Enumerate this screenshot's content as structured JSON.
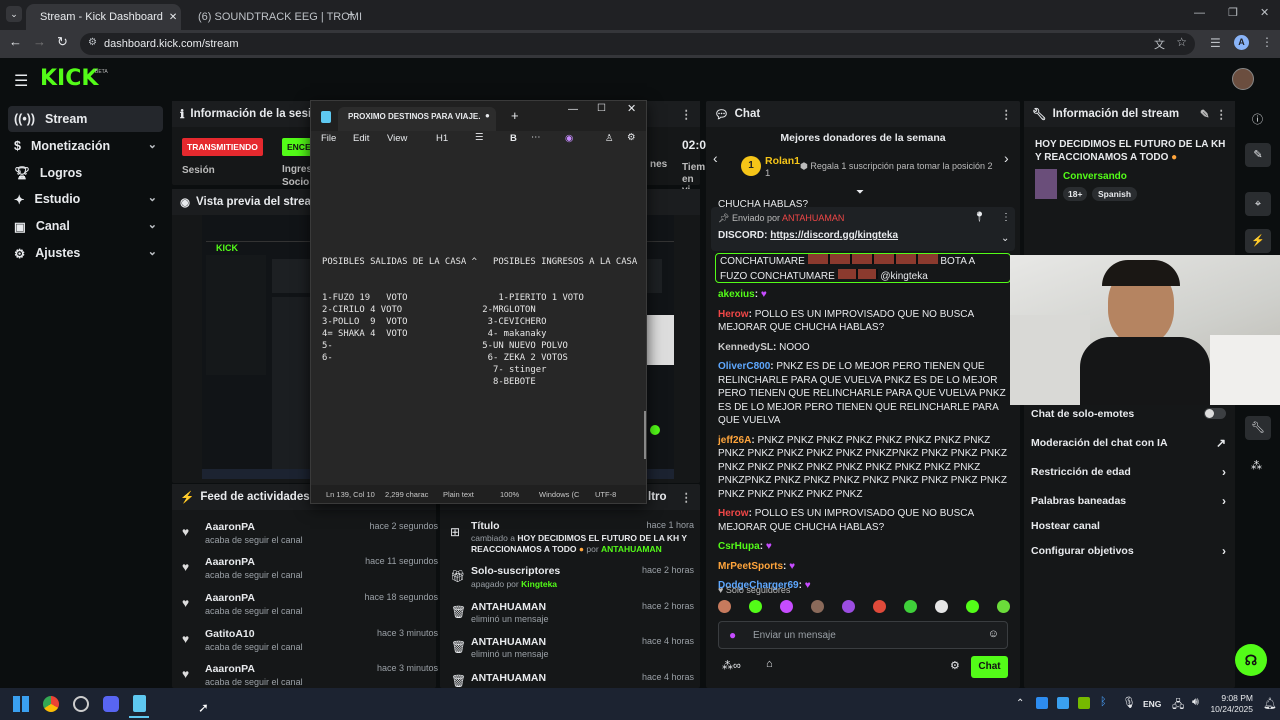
{
  "browser": {
    "tabs": [
      {
        "title": "Stream - Kick Dashboard",
        "active": true
      },
      {
        "title": "(6) SOUNDTRACK EEG | TROMI",
        "active": false
      }
    ],
    "url": "dashboard.kick.com/stream",
    "profile_initial": "A"
  },
  "brand": {
    "logo": "KICK",
    "beta": "BETA",
    "accent": "#53fc18"
  },
  "sidebar": {
    "items": [
      {
        "label": "Stream",
        "icon": "stream-icon",
        "selected": true
      },
      {
        "label": "Monetización",
        "icon": "money-icon",
        "chevron": true
      },
      {
        "label": "Logros",
        "icon": "trophy-icon"
      },
      {
        "label": "Estudio",
        "icon": "studio-icon",
        "chevron": true
      },
      {
        "label": "Canal",
        "icon": "channel-icon",
        "chevron": true
      },
      {
        "label": "Ajustes",
        "icon": "gear-icon",
        "chevron": true
      }
    ]
  },
  "session_panel": {
    "title": "Información de la sesión",
    "status_badge": "TRANSMITIENDO",
    "status_badge2": "ENCE",
    "session_label": "Sesión",
    "ingresos_label": "Ingres",
    "socio_label": "Socio",
    "time_value": "02:0",
    "tiem_label": "Tiem",
    "en_vi_label": "en vi",
    "nes_label": "nes"
  },
  "preview_panel": {
    "title": "Vista previa del stream"
  },
  "activity_feed": {
    "title": "Feed de actividades",
    "items": [
      {
        "name": "AaaronPA",
        "sub": "acaba de seguir el canal",
        "time": "hace 2 segundos"
      },
      {
        "name": "AaaronPA",
        "sub": "acaba de seguir el canal",
        "time": "hace 11 segundos"
      },
      {
        "name": "AaaronPA",
        "sub": "acaba de seguir el canal",
        "time": "hace 18 segundos"
      },
      {
        "name": "GatitoA10",
        "sub": "acaba de seguir el canal",
        "time": "hace 3 minutos"
      },
      {
        "name": "AaaronPA",
        "sub": "acaba de seguir el canal",
        "time": "hace 3 minutos"
      }
    ]
  },
  "mod_feed": {
    "title_suffix": "ltro",
    "items": [
      {
        "name": "Título",
        "sub_prefix": "cambiado a",
        "sub_bold": "HOY DECIDIMOS EL FUTURO DE LA KH Y REACCIONAMOS A TODO",
        "sub_by": "por",
        "sub_user": "ANTAHUAMAN",
        "time": "hace 1 hora",
        "icon": "title-icon"
      },
      {
        "name": "Solo-suscriptores",
        "sub_prefix": "apagado por",
        "sub_user": "Kingteka",
        "time": "hace 2 horas",
        "icon": "gift-icon"
      },
      {
        "name": "ANTAHUAMAN",
        "sub_prefix": "eliminó un mensaje",
        "time": "hace 2 horas",
        "icon": "trash-icon"
      },
      {
        "name": "ANTAHUAMAN",
        "sub_prefix": "eliminó un mensaje",
        "time": "hace 4 horas",
        "icon": "trash-icon"
      },
      {
        "name": "ANTAHUAMAN",
        "sub_prefix": "",
        "time": "hace 4 horas",
        "icon": "trash-icon"
      }
    ]
  },
  "notepad": {
    "title": "PROXIMO DESTINOS PARA VIAJE.",
    "menu": [
      "File",
      "Edit",
      "View"
    ],
    "heading_btn": "H1",
    "bold_btn": "B",
    "lines": [
      "POSIBLES SALIDAS DE LA CASA ^   POSIBLES INGRESOS A LA CASA",
      "",
      "",
      "1-FUZO 19   VOTO                 1-PIERITO 1 VOTO",
      "2-CIRILO 4 VOTO               2-MRGLOTON",
      "3-POLLO  9  VOTO               3-CEVICHERO",
      "4= SHAKA 4  VOTO               4- makanaky",
      "5-                            5-UN NUEVO POLVO",
      "6-                             6- ZEKA 2 VOTOS",
      "                                7- stinger",
      "                                8-BEBOTE"
    ],
    "status": {
      "position": "Ln 139, Col 10",
      "chars": "2,299 charac",
      "format": "Plain text",
      "zoom": "100%",
      "line_end": "Windows (C",
      "encoding": "UTF-8"
    }
  },
  "chat": {
    "title": "Chat",
    "donors_title": "Mejores donadores de la semana",
    "top_donor": {
      "rank": "1",
      "name": "Rolan1",
      "count": "1"
    },
    "donor_cta": "Regala 1 suscripción para tomar la posición 2",
    "pinned": {
      "sent_by": "Enviado por",
      "user": "ANTAHUAMAN",
      "label": "DISCORD:",
      "link": "https://discord.gg/kingteka"
    },
    "cut_line": "CHUCHA HABLAS?",
    "highlight": {
      "text1": "CONCHATUMARE",
      "text2": "BOTA A",
      "text3": "FUZO CONCHATUMARE",
      "mention": "@kingteka"
    },
    "messages": [
      {
        "user": "akexius",
        "color": "#53fc18",
        "text": ""
      },
      {
        "user": "Herow",
        "color": "#f04747",
        "text": "POLLO ES UN IMPROVISADO QUE NO BUSCA MEJORAR QUE CHUCHA HABLAS?"
      },
      {
        "user": "KennedySL",
        "color": "#c8c8c8",
        "text": "NOOO"
      },
      {
        "user": "OliverC800",
        "color": "#5ea8ff",
        "text": "PNKZ ES DE LO MEJOR PERO TIENEN QUE RELINCHARLE PARA QUE VUELVA  PNKZ ES DE LO MEJOR PERO TIENEN QUE RELINCHARLE PARA QUE VUELVA  PNKZ ES DE LO MEJOR PERO TIENEN QUE RELINCHARLE PARA QUE VUELVA"
      },
      {
        "user": "jeff26A",
        "color": "#ffa53c",
        "text": "PNKZ PNKZ PNKZ PNKZ PNKZ PNKZ PNKZ PNKZ PNKZ PNKZ PNKZ PNKZ PNKZ PNKZPNKZ PNKZ PNKZ PNKZ PNKZ PNKZ PNKZ PNKZ PNKZ PNKZ PNKZ PNKZ PNKZ PNKZPNKZ PNKZ PNKZ PNKZ PNKZ PNKZ PNKZ PNKZ PNKZ PNKZ PNKZ PNKZ PNKZ PNKZ"
      },
      {
        "user": "Herow",
        "color": "#f04747",
        "text": "POLLO ES UN IMPROVISADO QUE NO BUSCA MEJORAR QUE CHUCHA HABLAS?"
      },
      {
        "user": "CsrHupa",
        "color": "#53fc18",
        "text": ""
      },
      {
        "user": "MrPeetSports",
        "color": "#ffa53c",
        "text": ""
      },
      {
        "user": "DodgeCharger69",
        "color": "#5ea8ff",
        "text": ""
      }
    ],
    "followers_only": "Solo seguidores",
    "input_placeholder": "Enviar un mensaje",
    "send_label": "Chat"
  },
  "stream_info": {
    "title": "Información del stream",
    "stream_title": "HOY DECIDIMOS EL FUTURO DE LA KH Y REACCIONAMOS A TODO",
    "category": "Conversando",
    "tags": [
      "18+",
      "Spanish"
    ],
    "settings": [
      {
        "label": "Chat de solo-emotes",
        "control": "toggle"
      },
      {
        "label": "Moderación del chat con IA",
        "control": "external"
      },
      {
        "label": "Restricción de edad",
        "control": "arrow"
      },
      {
        "label": "Palabras baneadas",
        "control": "arrow"
      },
      {
        "label": "Hostear canal",
        "control": "none"
      },
      {
        "label": "Configurar objetivos",
        "control": "arrow"
      }
    ]
  },
  "taskbar": {
    "language": "ENG",
    "time": "9:08 PM",
    "date": "10/24/2025"
  }
}
